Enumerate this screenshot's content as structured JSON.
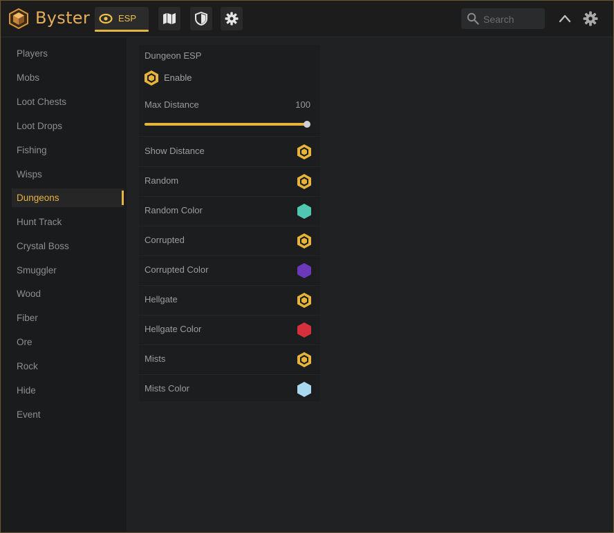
{
  "app": {
    "brand": "Byster"
  },
  "topbar": {
    "tabs": [
      {
        "label": "ESP",
        "icon": "eye-icon",
        "active": true
      },
      {
        "icon": "map-icon"
      },
      {
        "icon": "shield-icon"
      },
      {
        "icon": "gear-icon"
      }
    ],
    "search_placeholder": "Search"
  },
  "sidebar": {
    "items": [
      {
        "label": "Players"
      },
      {
        "label": "Mobs"
      },
      {
        "label": "Loot Chests"
      },
      {
        "label": "Loot Drops"
      },
      {
        "label": "Fishing"
      },
      {
        "label": "Wisps"
      },
      {
        "label": "Dungeons",
        "active": true
      },
      {
        "label": "Hunt Track"
      },
      {
        "label": "Crystal Boss"
      },
      {
        "label": "Smuggler"
      },
      {
        "label": "Wood"
      },
      {
        "label": "Fiber"
      },
      {
        "label": "Ore"
      },
      {
        "label": "Rock"
      },
      {
        "label": "Hide"
      },
      {
        "label": "Event"
      }
    ]
  },
  "panel": {
    "title": "Dungeon ESP",
    "enable_label": "Enable",
    "max_distance": {
      "label": "Max Distance",
      "value": "100",
      "fill_percent": 100
    },
    "rows": [
      {
        "label": "Show Distance",
        "type": "toggle",
        "color": "#e6b43a"
      },
      {
        "label": "Random",
        "type": "toggle",
        "color": "#e6b43a"
      },
      {
        "label": "Random Color",
        "type": "color",
        "color": "#4fc7b3"
      },
      {
        "label": "Corrupted",
        "type": "toggle",
        "color": "#e6b43a"
      },
      {
        "label": "Corrupted Color",
        "type": "color",
        "color": "#6a38b8"
      },
      {
        "label": "Hellgate",
        "type": "toggle",
        "color": "#e6b43a"
      },
      {
        "label": "Hellgate Color",
        "type": "color",
        "color": "#d6303c"
      },
      {
        "label": "Mists",
        "type": "toggle",
        "color": "#e6b43a"
      },
      {
        "label": "Mists Color",
        "type": "color",
        "color": "#a7d8ef"
      }
    ]
  },
  "colors": {
    "accent": "#e6b43a",
    "background": "#1f2021",
    "text": "#9a9a9a"
  }
}
